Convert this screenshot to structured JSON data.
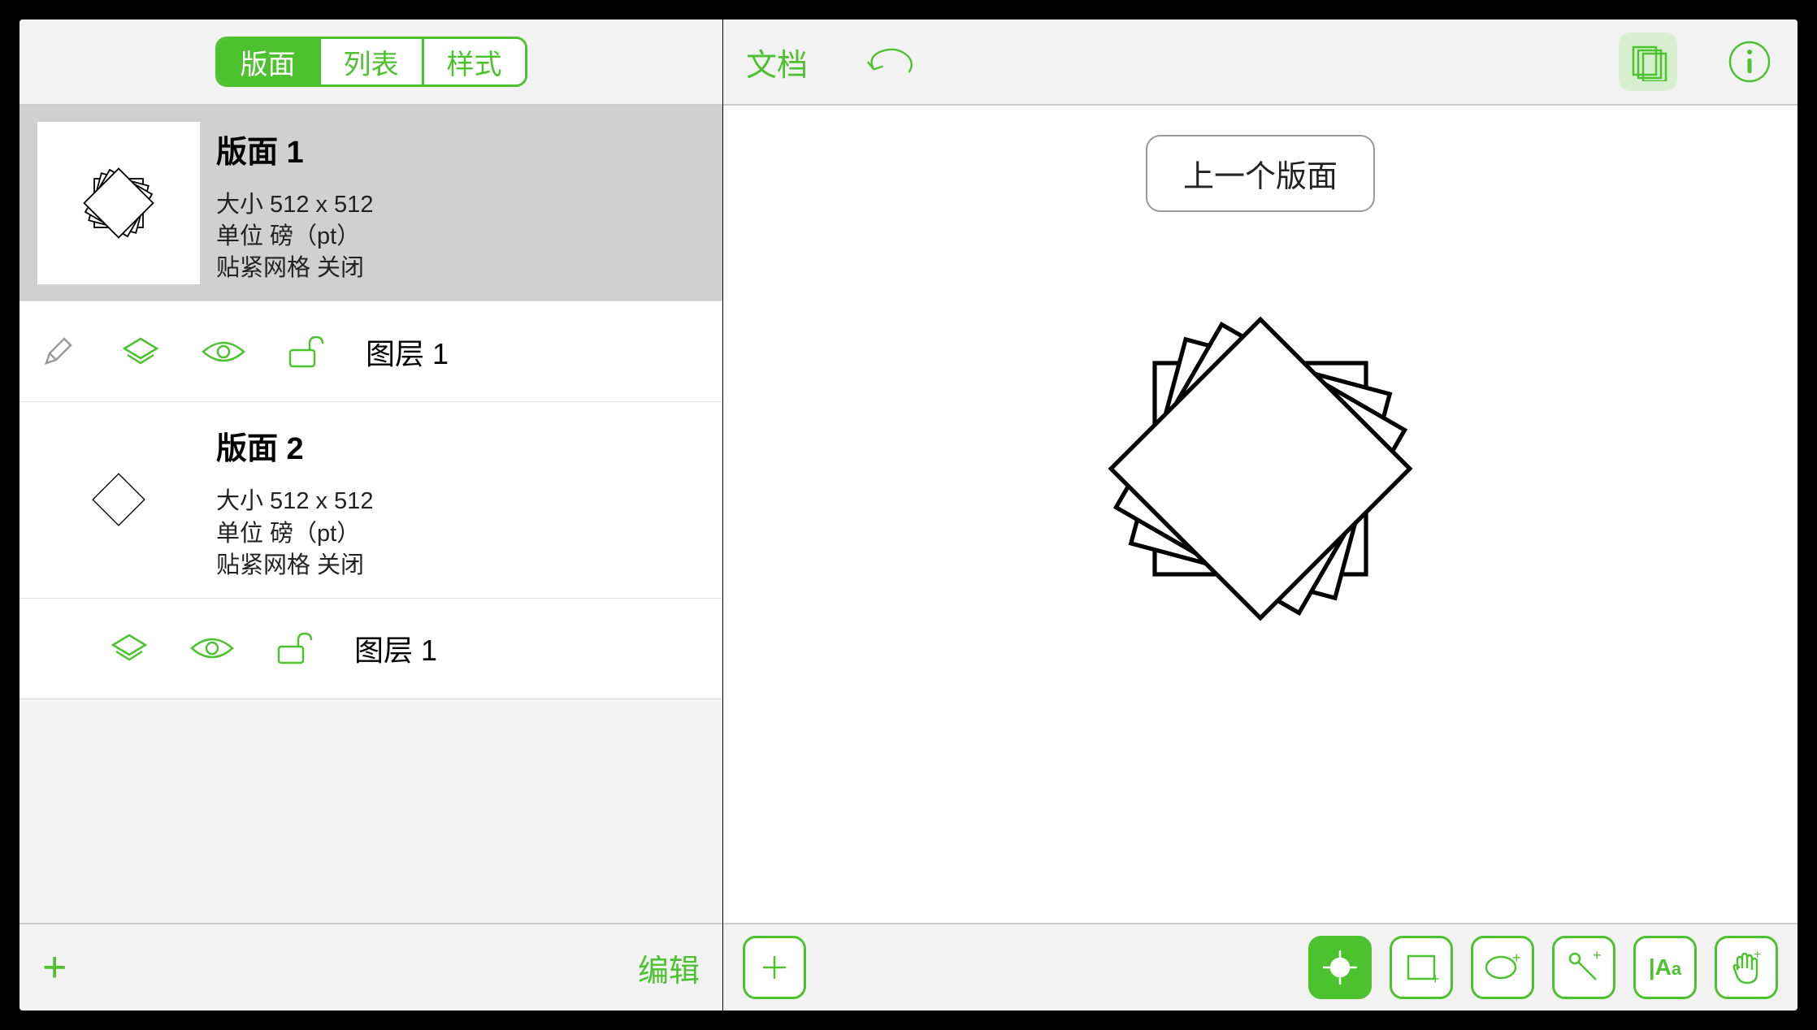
{
  "accent": "#4cc22f",
  "sidebar": {
    "tabs": [
      {
        "label": "版面",
        "active": true
      },
      {
        "label": "列表",
        "active": false
      },
      {
        "label": "样式",
        "active": false
      }
    ],
    "canvases": [
      {
        "title": "版面 1",
        "size_label": "大小 512 x 512",
        "units_label": "单位 磅（pt）",
        "snap_label": "贴紧网格 关闭",
        "selected": true,
        "layer_label": "图层 1"
      },
      {
        "title": "版面 2",
        "size_label": "大小 512 x 512",
        "units_label": "单位 磅（pt）",
        "snap_label": "贴紧网格 关闭",
        "selected": false,
        "layer_label": "图层 1"
      }
    ],
    "footer": {
      "add_label": "+",
      "edit_label": "编辑"
    }
  },
  "header": {
    "document_label": "文档"
  },
  "canvas": {
    "prev_button_label": "上一个版面"
  },
  "icons": {
    "undo": "undo-icon",
    "stack": "canvases-stack-icon",
    "info": "info-icon",
    "pencil": "pencil-icon",
    "layers": "layers-icon",
    "eye": "visibility-icon",
    "lock": "unlock-icon",
    "plus": "add-icon",
    "move": "crosshair-tool",
    "rect": "rectangle-tool",
    "ellipse": "ellipse-tool",
    "pen": "pen-tool",
    "text": "text-tool",
    "hand": "hand-tool"
  }
}
